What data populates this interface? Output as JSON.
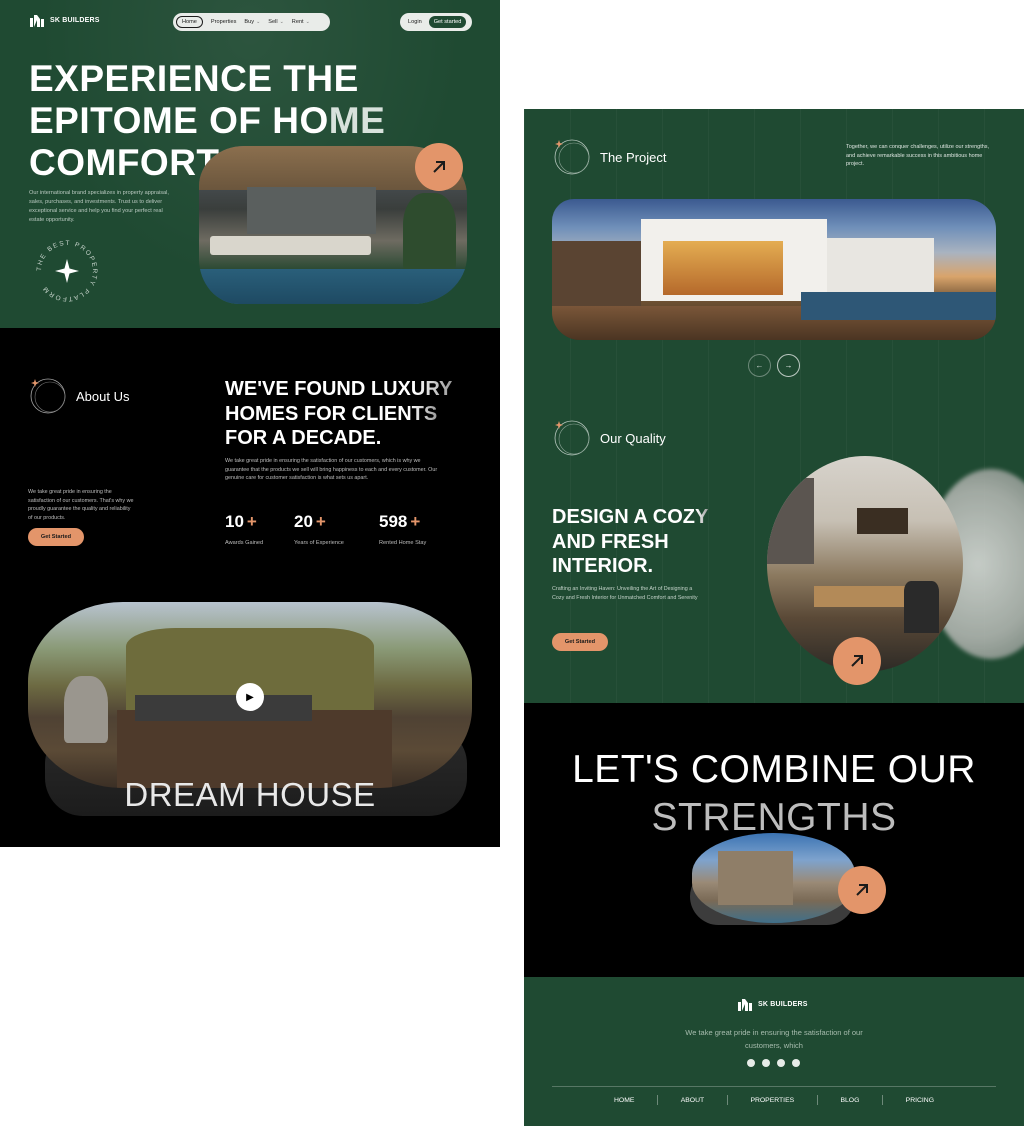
{
  "brand": {
    "name": "SK BUILDERS"
  },
  "header": {
    "nav": [
      {
        "label": "Home",
        "active": true
      },
      {
        "label": "Properties"
      },
      {
        "label": "Buy"
      },
      {
        "label": "Sell"
      },
      {
        "label": "Rent"
      }
    ],
    "login_label": "Login",
    "cta_label": "Get started"
  },
  "hero": {
    "title_line1": "EXPERIENCE THE",
    "title_line2_a": "EPITOME OF HO",
    "title_line2_b": "ME",
    "title_line3": "COMFORT.",
    "description": "Our international brand specializes in property appraisal, sales, purchases, and investments. Trust us to deliver exceptional service and help you find your perfect real estate opportunity.",
    "badge_text": "THE BEST PROPERTY PLATFORM"
  },
  "about": {
    "label": "About Us",
    "title_a": "WE'VE FOUND ",
    "title_b": "LUXURY",
    "title_c": "HOMES FOR CL",
    "title_d": "IENTS",
    "title_e": "FOR A DECADE.",
    "paragraph": "We take great pride in ensuring the satisfaction of our customers, which is why we guarantee that the products we sell will bring happiness to each and every customer. Our genuine care for customer satisfaction is what sets us apart.",
    "side_text": "We take great pride in ensuring the satisfaction of our customers. That's why we proudly guarantee the quality and reliability of our products.",
    "button_label": "Get Started",
    "stats": [
      {
        "value": "10",
        "suffix": "+",
        "label": "Awards Gained"
      },
      {
        "value": "20",
        "suffix": "+",
        "label": "Years of Experience"
      },
      {
        "value": "598",
        "suffix": "+",
        "label": "Rented Home Stay"
      }
    ],
    "video_title": "DREAM HOUSE"
  },
  "project": {
    "label": "The Project",
    "text": "Together, we can conquer challenges, utilize our strengths, and achieve remarkable success in this ambitious home project."
  },
  "quality": {
    "label": "Our Quality",
    "title_a": "DESIGN A CO",
    "title_b": "ZY",
    "title_c": "AND FRESH",
    "title_d": "INTERIOR.",
    "description": "Crafting an Inviting Haven: Unveiling the Art of Designing a Cozy and Fresh Interior for Unmatched Comfort and Serenity",
    "button_label": "Get Started"
  },
  "combine": {
    "line1": "LET'S COMBINE OUR",
    "line2": "STRENGTHS"
  },
  "footer": {
    "text": "We take great pride in ensuring the satisfaction of our customers, which",
    "social_icons": [
      "facebook-icon",
      "twitter-icon",
      "instagram-icon",
      "linkedin-icon"
    ],
    "nav": [
      "HOME",
      "ABOUT",
      "PROPERTIES",
      "BLOG",
      "PRICING"
    ]
  },
  "colors": {
    "green": "#1f4a32",
    "accent": "#e3956a",
    "black": "#000000"
  }
}
